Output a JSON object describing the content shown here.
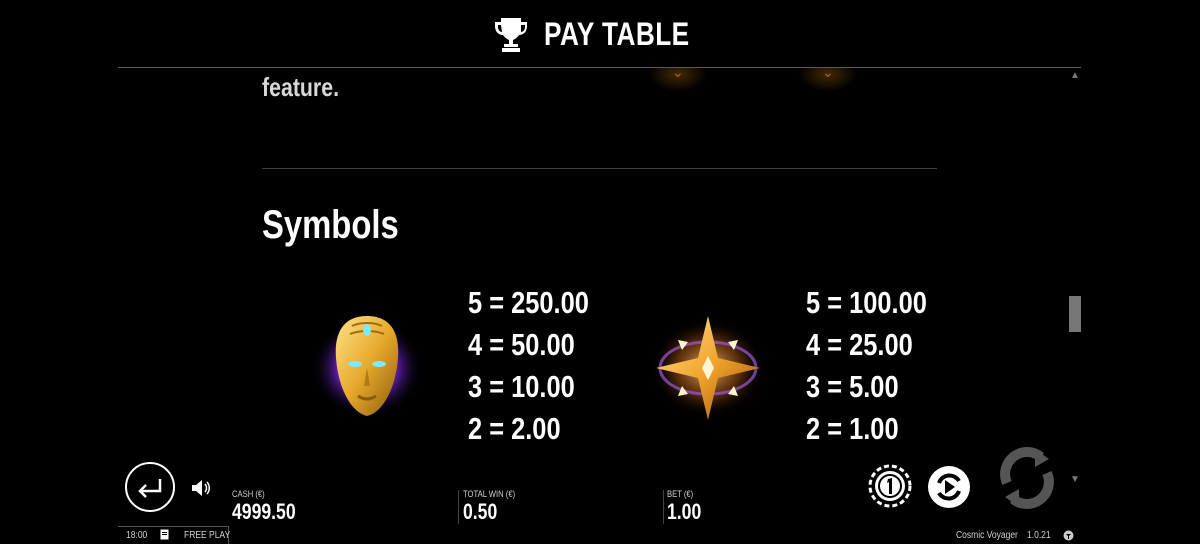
{
  "header": {
    "title": "PAY TABLE",
    "icon": "trophy-icon"
  },
  "content": {
    "feature_text": "feature.",
    "section_title": "Symbols",
    "symbols": [
      {
        "icon": "golden-mask-icon",
        "payouts": [
          "5 = 250.00",
          "4 = 50.00",
          "3 = 10.00",
          "2 = 2.00"
        ]
      },
      {
        "icon": "golden-star-icon",
        "payouts": [
          "5 = 100.00",
          "4 = 25.00",
          "3 = 5.00",
          "2 = 1.00"
        ]
      }
    ]
  },
  "bottom_bar": {
    "cash_label": "CASH (€)",
    "cash_value": "4999.50",
    "total_win_label": "TOTAL WIN (€)",
    "total_win_value": "0.50",
    "bet_label": "BET (€)",
    "bet_value": "1.00"
  },
  "footer": {
    "time": "18:00",
    "mode": "FREE PLAY",
    "game_name": "Cosmic Voyager",
    "version": "1.0.21"
  },
  "colors": {
    "background": "#000000",
    "text": "#ffffff",
    "gold": "#e7a92b",
    "muted": "#777777"
  }
}
